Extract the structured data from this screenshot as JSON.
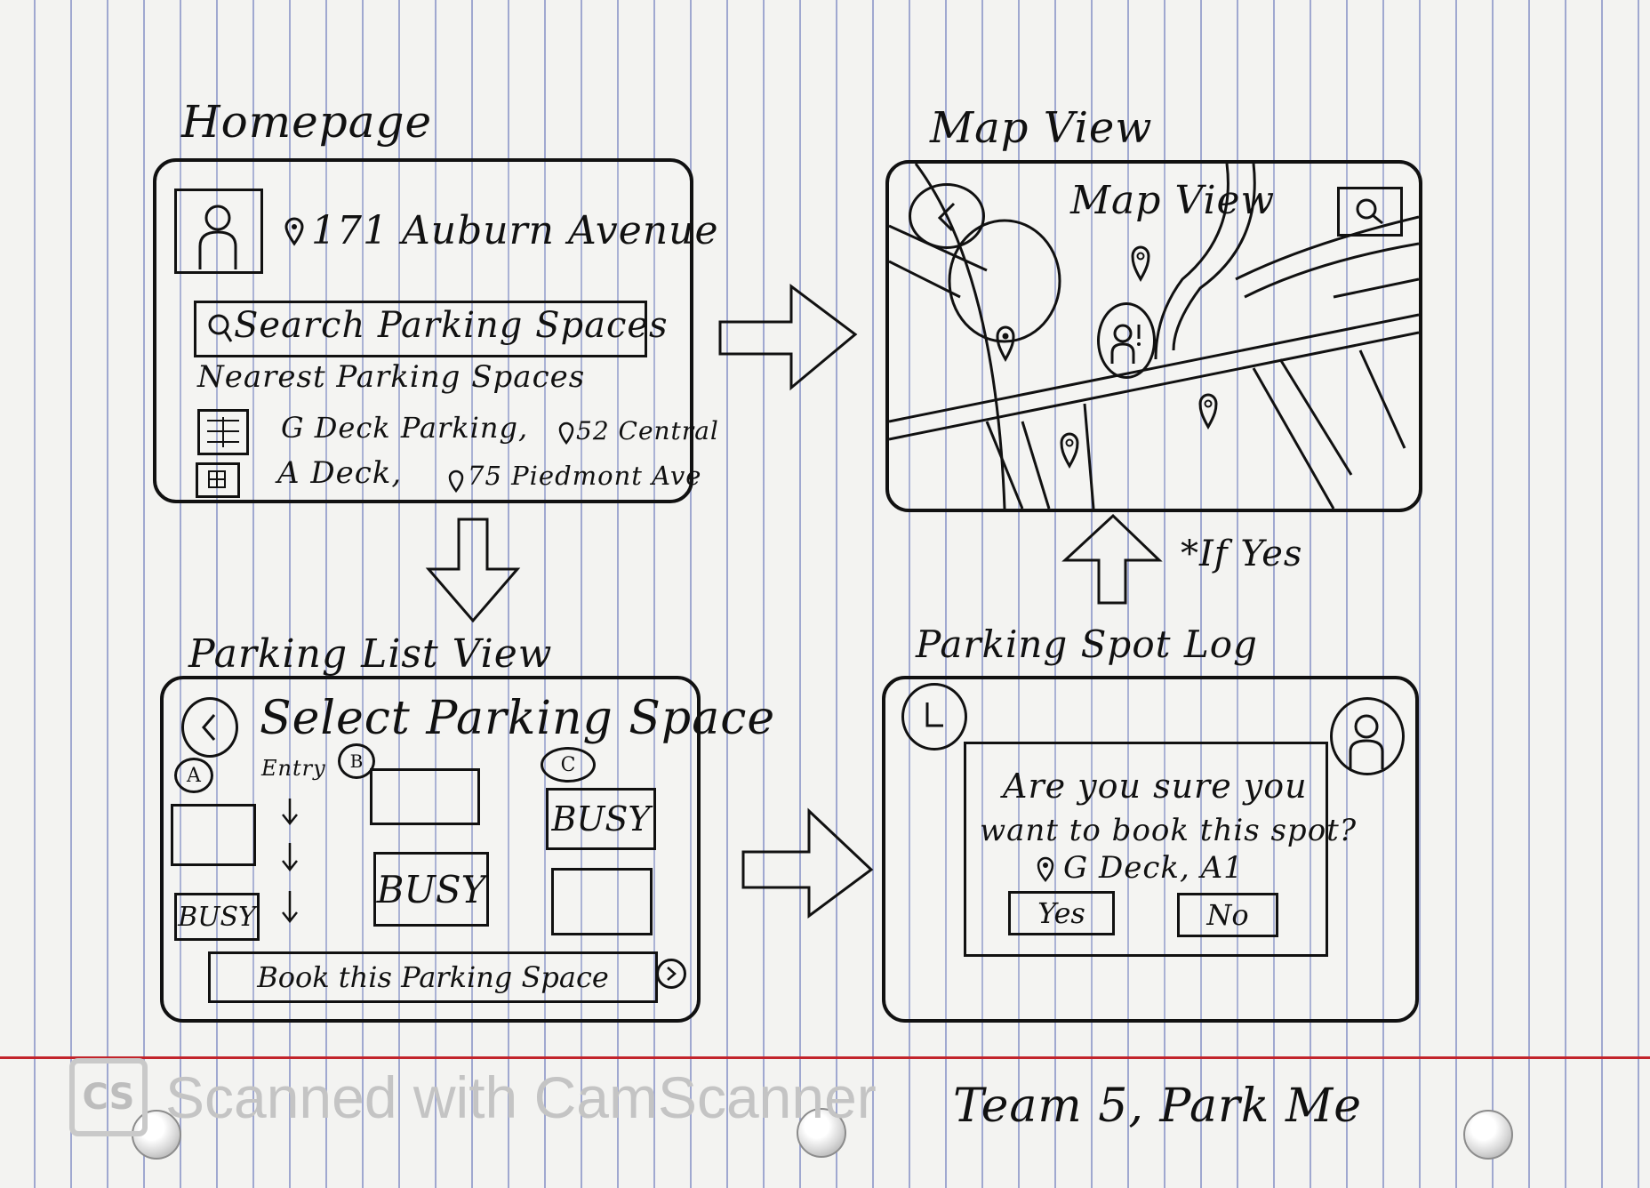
{
  "screens": {
    "homepage": {
      "heading": "Homepage",
      "address": "171 Auburn Avenue",
      "search_label": "Search Parking Spaces",
      "nearest_heading": "Nearest Parking Spaces",
      "spaces": [
        {
          "name": "G Deck Parking,",
          "address": "52 Central"
        },
        {
          "name": "A Deck,",
          "address": "75 Piedmont Ave"
        }
      ]
    },
    "map_view": {
      "heading": "Map View",
      "title": "Map View"
    },
    "parking_list": {
      "heading": "Parking List View",
      "title": "Select Parking Space",
      "entry_label": "Entry",
      "sections": [
        "A",
        "B",
        "C"
      ],
      "busy_label": "BUSY",
      "book_button": "Book this Parking Space"
    },
    "spot_log": {
      "heading": "Parking Spot Log",
      "question_line1": "Are you sure you",
      "question_line2": "want to book this spot?",
      "spot": "G Deck, A1",
      "yes": "Yes",
      "no": "No"
    }
  },
  "annotation": "*If Yes",
  "footer": "Team 5, Park Me",
  "watermark": {
    "logo": "CS",
    "text": "Scanned with CamScanner"
  },
  "colors": {
    "ink": "#111111",
    "margin_line": "#c2242b",
    "rule_lines": "#2838a0"
  },
  "icons": [
    "profile-icon",
    "location-pin-icon",
    "search-icon",
    "back-icon",
    "map-pin-icon",
    "parking-grid-icon",
    "forward-icon"
  ]
}
